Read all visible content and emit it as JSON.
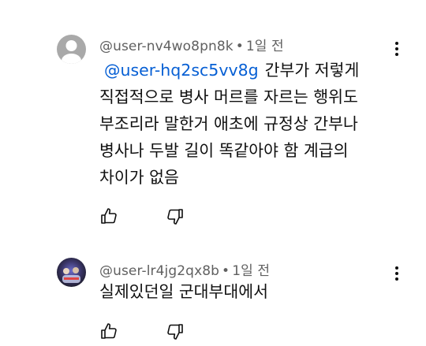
{
  "comments": [
    {
      "author": "@user-nv4wo8pn8k",
      "separator": "•",
      "time": "1일 전",
      "mention": "@user-hq2sc5vv8g",
      "text_lines": [
        "간부가 저렇게",
        "직접적으로 병사 머르를 자르는 행위도",
        "부조리라  말한거 애초에 규정상 간부나",
        "병사나 두발 길이 똑같아야 함 계급의",
        "차이가 없음"
      ],
      "avatar_icon": "default-avatar-icon",
      "like_icon": "thumbs-up-icon",
      "dislike_icon": "thumbs-down-icon",
      "menu_icon": "more-vert-icon"
    },
    {
      "author": "@user-lr4jg2qx8b",
      "separator": "•",
      "time": "1일 전",
      "text_lines": [
        "실제있던일 군대부대에서"
      ],
      "avatar_icon": "photo-avatar-icon",
      "like_icon": "thumbs-up-icon",
      "dislike_icon": "thumbs-down-icon",
      "menu_icon": "more-vert-icon"
    }
  ],
  "colors": {
    "text": "#0f0f0f",
    "meta": "#606060",
    "mention": "#065fd4",
    "avatar_bg": "#a9a9a9"
  }
}
